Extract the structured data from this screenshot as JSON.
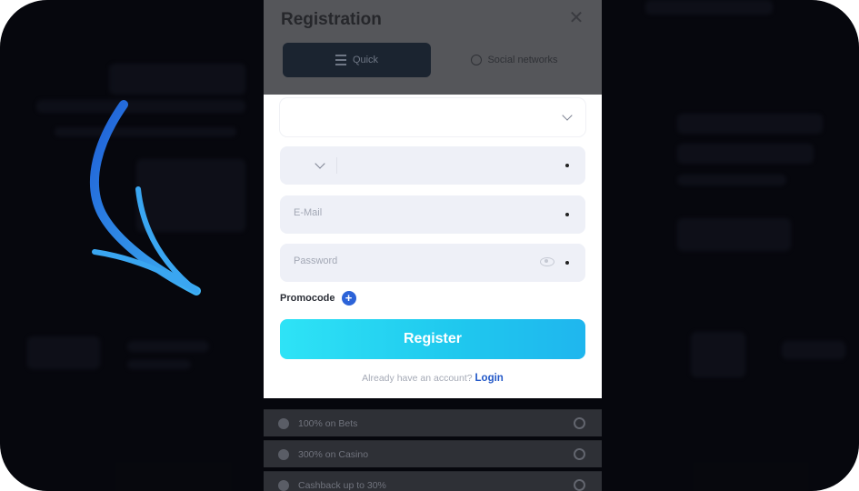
{
  "modal": {
    "title": "Registration",
    "close_symbol": "✕",
    "tabs": [
      {
        "label": "Quick",
        "icon": "menu-icon",
        "active": true
      },
      {
        "label": "Social networks",
        "icon": "globe-icon",
        "active": false
      }
    ]
  },
  "form": {
    "email_placeholder": "E-Mail",
    "password_placeholder": "Password",
    "promocode_label": "Promocode",
    "register_label": "Register",
    "have_account_text": "Already have an account?",
    "login_label": "Login"
  },
  "bonuses": [
    {
      "text": "100% on Bets"
    },
    {
      "text": "300% on Casino"
    },
    {
      "text": "Cashback up to 30%"
    }
  ],
  "colors": {
    "register_gradient_start": "#2ee3f6",
    "register_gradient_end": "#1fb6ee",
    "login_link": "#2459c8",
    "arrow": "#2f7bea"
  }
}
